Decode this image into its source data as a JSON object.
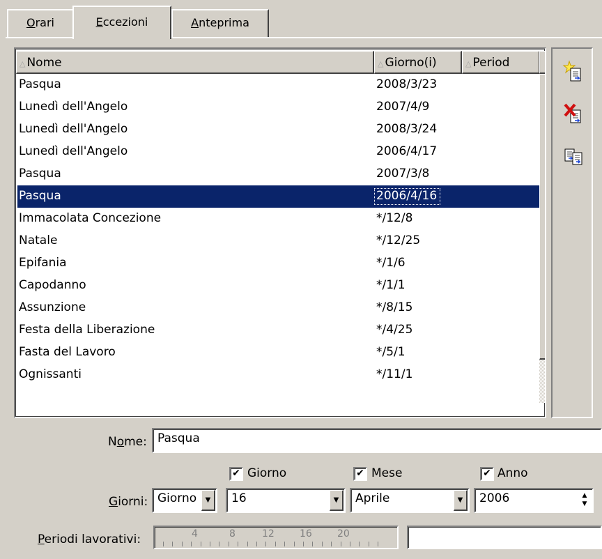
{
  "tabs": [
    {
      "label": "Orari",
      "accel": "O",
      "rest": "rari"
    },
    {
      "label": "Eccezioni",
      "accel": "E",
      "rest": "ccezioni",
      "active": true
    },
    {
      "label": "Anteprima",
      "accel": "A",
      "rest": "nteprima"
    }
  ],
  "list": {
    "columns": [
      "Nome",
      "Giorno(i)",
      "Period"
    ],
    "rows": [
      {
        "nome": "Pasqua",
        "giorno": "2008/3/23"
      },
      {
        "nome": "Lunedì dell'Angelo",
        "giorno": "2007/4/9"
      },
      {
        "nome": "Lunedì dell'Angelo",
        "giorno": "2008/3/24"
      },
      {
        "nome": "Lunedì dell'Angelo",
        "giorno": "2006/4/17"
      },
      {
        "nome": "Pasqua",
        "giorno": "2007/3/8"
      },
      {
        "nome": "Pasqua",
        "giorno": "2006/4/16",
        "selected": true
      },
      {
        "nome": "Immacolata Concezione",
        "giorno": "*/12/8"
      },
      {
        "nome": "Natale",
        "giorno": "*/12/25"
      },
      {
        "nome": "Epifania",
        "giorno": "*/1/6"
      },
      {
        "nome": "Capodanno",
        "giorno": "*/1/1"
      },
      {
        "nome": "Assunzione",
        "giorno": "*/8/15"
      },
      {
        "nome": "Festa della Liberazione",
        "giorno": "*/4/25"
      },
      {
        "nome": "Fasta del Lavoro",
        "giorno": "*/5/1"
      },
      {
        "nome": "Ognissanti",
        "giorno": "*/11/1"
      }
    ]
  },
  "toolbar": {
    "icons": [
      "new-item-icon",
      "delete-item-icon",
      "duplicate-item-icon"
    ]
  },
  "form": {
    "nome_label_pre": "N",
    "nome_label_accel": "o",
    "nome_label_post": "me:",
    "nome_value": "Pasqua",
    "giorni_label_accel": "G",
    "giorni_label_rest": "iorni:",
    "giorni_type": "Giorno",
    "check_giorno": "Giorno",
    "check_mese": "Mese",
    "check_anno": "Anno",
    "giorno_value": "16",
    "mese_value": "Aprile",
    "anno_value": "2006",
    "periodi_label_accel": "P",
    "periodi_label_rest": "eriodi lavorativi:",
    "ruler_numbers": [
      "4",
      "8",
      "12",
      "16",
      "20"
    ]
  },
  "colors": {
    "selection": "#0a246a",
    "face": "#d4d0c8"
  }
}
